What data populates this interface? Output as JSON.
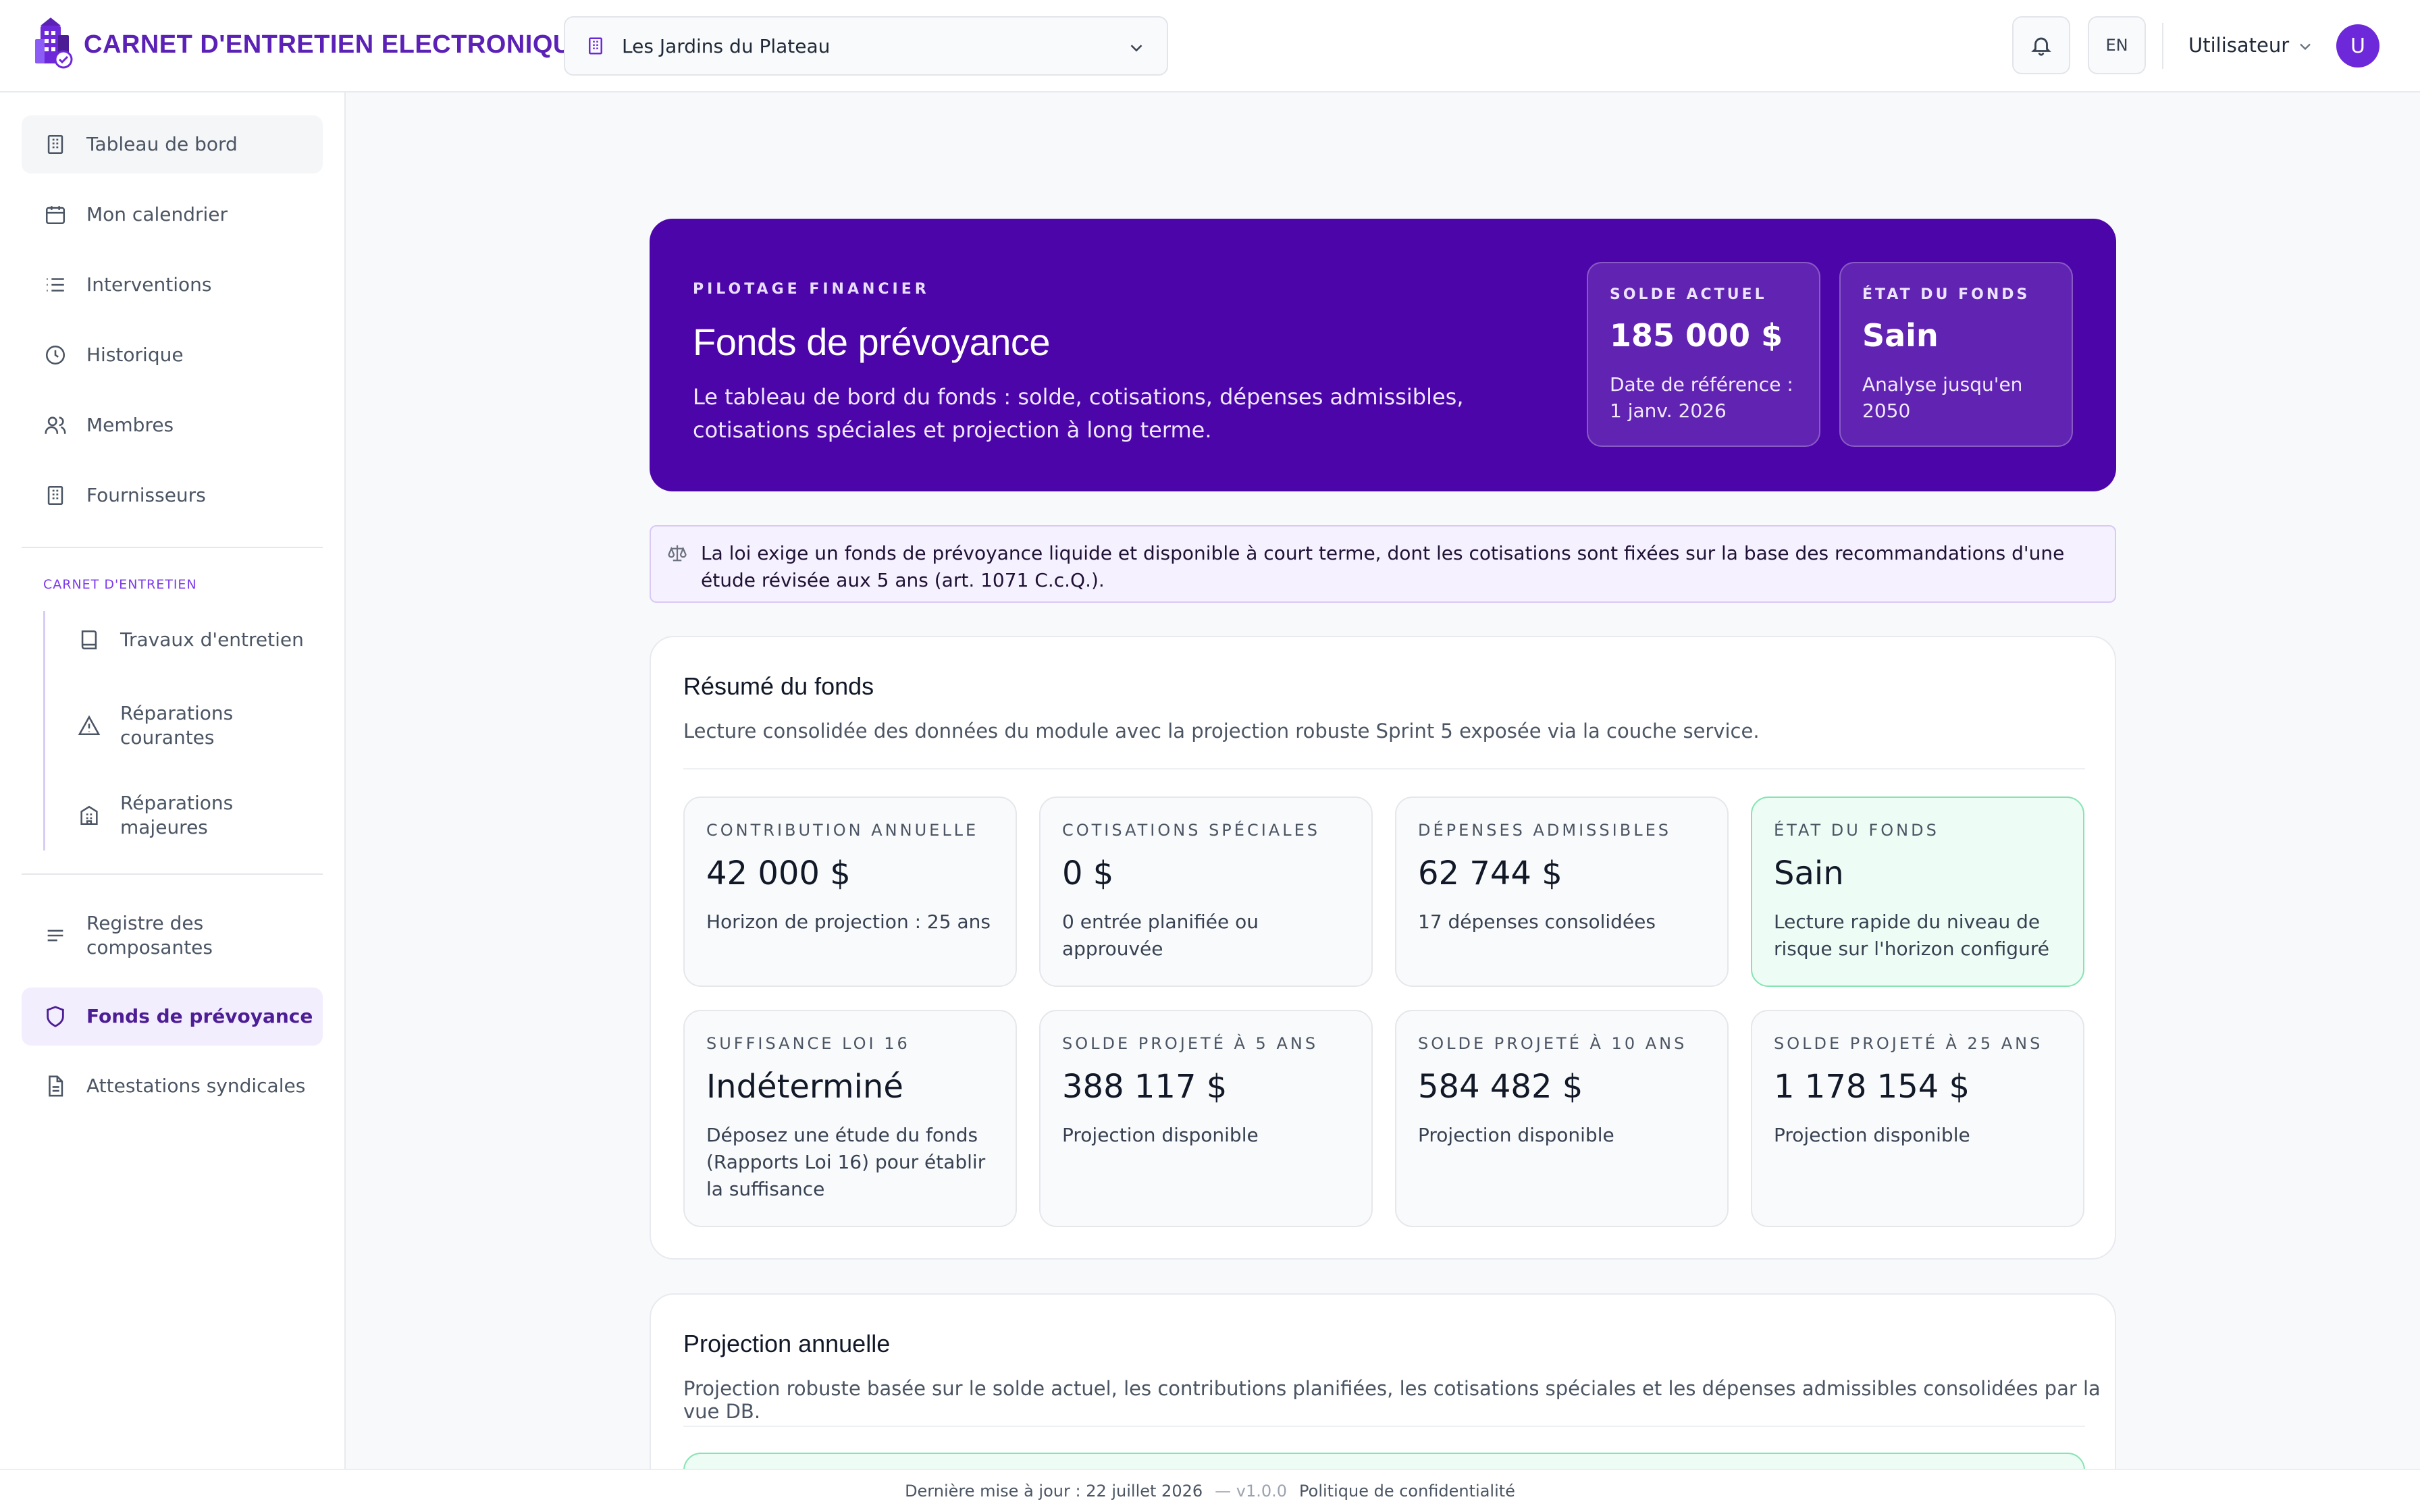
{
  "app": {
    "title": "CARNET D'ENTRETIEN ELECTRONIQUE",
    "accent": "#5b21b6"
  },
  "header": {
    "building": "Les Jardins du Plateau",
    "lang": "EN",
    "user_name": "Utilisateur",
    "avatar_initial": "U"
  },
  "sidebar": {
    "items": [
      {
        "label": "Tableau de bord",
        "icon": "building-icon"
      },
      {
        "label": "Mon calendrier",
        "icon": "calendar-icon"
      },
      {
        "label": "Interventions",
        "icon": "list-icon"
      },
      {
        "label": "Historique",
        "icon": "clock-icon"
      },
      {
        "label": "Membres",
        "icon": "users-icon"
      },
      {
        "label": "Fournisseurs",
        "icon": "building-icon"
      }
    ],
    "section_label": "CARNET D'ENTRETIEN",
    "sub_items": [
      {
        "label": "Travaux d'entretien",
        "icon": "book-icon"
      },
      {
        "label": "Réparations courantes",
        "icon": "warning-icon"
      },
      {
        "label": "Réparations majeures",
        "icon": "hospital-icon"
      }
    ],
    "bottom_items": [
      {
        "label": "Registre des composantes",
        "icon": "lines-icon"
      },
      {
        "label": "Fonds de prévoyance",
        "icon": "shield-icon"
      },
      {
        "label": "Attestations syndicales",
        "icon": "document-icon"
      }
    ]
  },
  "hero": {
    "kicker": "PILOTAGE FINANCIER",
    "title": "Fonds de prévoyance",
    "description": "Le tableau de bord du fonds : solde, cotisations, dépenses admissibles, cotisations spéciales et projection à long terme.",
    "cards": [
      {
        "label": "SOLDE ACTUEL",
        "value": "185 000 $",
        "sub": "Date de référence : 1 janv. 2026"
      },
      {
        "label": "ÉTAT DU FONDS",
        "value": "Sain",
        "sub": "Analyse jusqu'en 2050"
      }
    ]
  },
  "alert": {
    "text": "La loi exige un fonds de prévoyance liquide et disponible à court terme, dont les cotisations sont fixées sur la base des recommandations d'une étude révisée aux 5 ans (art. 1071 C.c.Q.)."
  },
  "summary": {
    "title": "Résumé du fonds",
    "subtitle": "Lecture consolidée des données du module avec la projection robuste Sprint 5 exposée via la couche service.",
    "metrics": [
      {
        "label": "CONTRIBUTION ANNUELLE",
        "value": "42 000 $",
        "sub": "Horizon de projection : 25 ans"
      },
      {
        "label": "COTISATIONS SPÉCIALES",
        "value": "0 $",
        "sub": "0 entrée planifiée ou approuvée"
      },
      {
        "label": "DÉPENSES ADMISSIBLES",
        "value": "62 744 $",
        "sub": "17 dépenses consolidées"
      },
      {
        "label": "ÉTAT DU FONDS",
        "value": "Sain",
        "sub": "Lecture rapide du niveau de risque sur l'horizon configuré"
      },
      {
        "label": "SUFFISANCE LOI 16",
        "value": "Indéterminé",
        "sub": "Déposez une étude du fonds (Rapports Loi 16) pour établir la suffisance"
      },
      {
        "label": "SOLDE PROJETÉ À 5 ANS",
        "value": "388 117 $",
        "sub": "Projection disponible"
      },
      {
        "label": "SOLDE PROJETÉ À 10 ANS",
        "value": "584 482 $",
        "sub": "Projection disponible"
      },
      {
        "label": "SOLDE PROJETÉ À 25 ANS",
        "value": "1 178 154 $",
        "sub": "Projection disponible"
      }
    ]
  },
  "projection": {
    "title": "Projection annuelle",
    "subtitle": "Projection robuste basée sur le solde actuel, les contributions planifiées, les cotisations spéciales et les dépenses admissibles consolidées par la vue DB."
  },
  "footer": {
    "updated": "Dernière mise à jour : 22 juillet 2026",
    "version": "— v1.0.0",
    "privacy": "Politique de confidentialité"
  }
}
